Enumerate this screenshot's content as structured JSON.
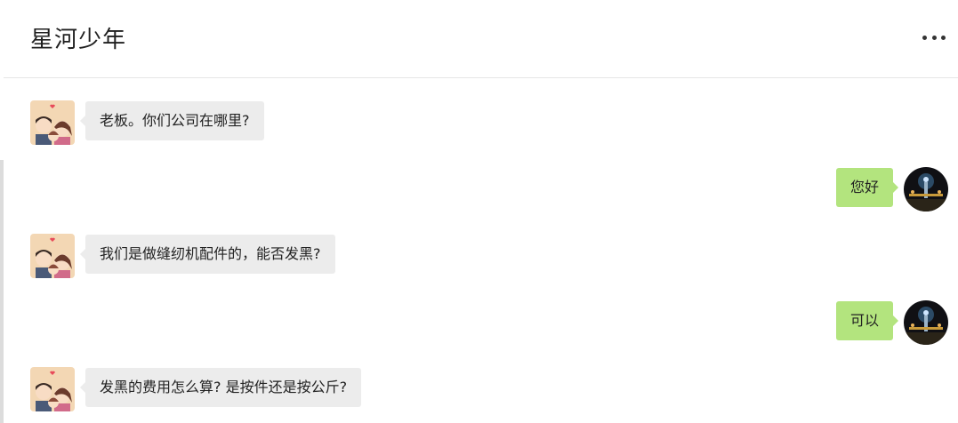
{
  "header": {
    "title": "星河少年",
    "more_icon": "more-horizontal-icon"
  },
  "messages": [
    {
      "side": "left",
      "text": "老板。你们公司在哪里?"
    },
    {
      "side": "right",
      "text": "您好"
    },
    {
      "side": "left",
      "text": "我们是做缝纫机配件的，能否发黑?"
    },
    {
      "side": "right",
      "text": "可以"
    },
    {
      "side": "left",
      "text": "发黑的费用怎么算? 是按件还是按公斤?"
    }
  ],
  "colors": {
    "incoming_bubble": "#ececec",
    "outgoing_bubble": "#b3e47e",
    "divider": "#e6e6e6"
  }
}
